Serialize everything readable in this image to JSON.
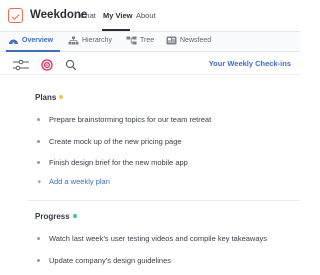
{
  "app": {
    "name": "Weekdone",
    "nav": [
      "Chat",
      "My View",
      "About"
    ],
    "active_nav": "My View"
  },
  "tabs": [
    {
      "label": "Overview",
      "icon": "overview-icon",
      "active": true
    },
    {
      "label": "Hierarchy",
      "icon": "hierarchy-icon",
      "active": false
    },
    {
      "label": "Tree",
      "icon": "tree-icon",
      "active": false
    },
    {
      "label": "Newsfeed",
      "icon": "newsfeed-icon",
      "active": false
    }
  ],
  "toolbar": {
    "icons": [
      "filter-icon",
      "target-icon",
      "search-icon"
    ],
    "checkin_link": "Your Weekly Check-ins"
  },
  "plans": {
    "title": "Plans",
    "status_color": "#f5c542",
    "items": [
      "Prepare brainstorming topics for our team retreat",
      "Create mock up of the new pricing page",
      "Finish design brief for the new mobile app"
    ],
    "add_label": "Add a weekly plan"
  },
  "progress": {
    "title": "Progress",
    "status_color": "#37c99a",
    "items": [
      "Watch last week’s user testing videos and compile key takeaways",
      "Update company’s design guidelines"
    ]
  },
  "colors": {
    "accent": "#3a6fc9",
    "brand": "#f06a4d"
  }
}
